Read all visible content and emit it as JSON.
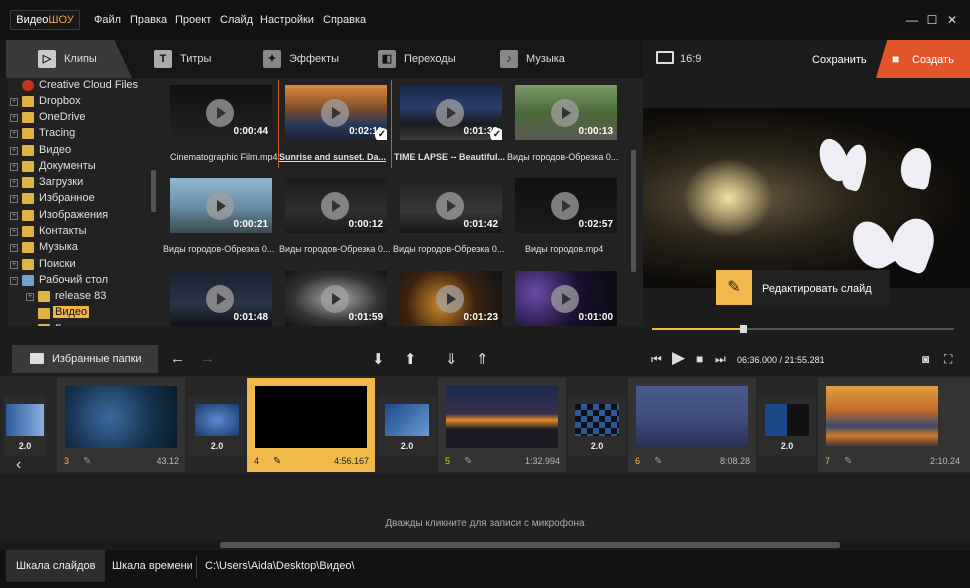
{
  "app": {
    "logo_a": "Видео",
    "logo_b": "ШОУ"
  },
  "menu": [
    "Файл",
    "Правка",
    "Проект",
    "Слайд",
    "Настройки",
    "Справка"
  ],
  "tabs": [
    {
      "label": "Клипы",
      "icon": "play-icon"
    },
    {
      "label": "Титры",
      "icon": "text-icon"
    },
    {
      "label": "Эффекты",
      "icon": "magic-wand-icon"
    },
    {
      "label": "Переходы",
      "icon": "transition-icon"
    },
    {
      "label": "Музыка",
      "icon": "music-icon"
    }
  ],
  "header": {
    "aspect": "16:9",
    "save": "Сохранить",
    "create": "Создать"
  },
  "tree": [
    {
      "label": "Creative Cloud Files",
      "type": "cloud"
    },
    {
      "label": "Dropbox",
      "type": "folder"
    },
    {
      "label": "OneDrive",
      "type": "folder"
    },
    {
      "label": "Tracing",
      "type": "folder"
    },
    {
      "label": "Видео",
      "type": "folder"
    },
    {
      "label": "Документы",
      "type": "folder"
    },
    {
      "label": "Загрузки",
      "type": "folder"
    },
    {
      "label": "Избранное",
      "type": "folder"
    },
    {
      "label": "Изображения",
      "type": "folder"
    },
    {
      "label": "Контакты",
      "type": "folder"
    },
    {
      "label": "Музыка",
      "type": "folder"
    },
    {
      "label": "Поиски",
      "type": "folder"
    },
    {
      "label": "Рабочий стол",
      "type": "folder"
    },
    {
      "label": "release 83",
      "type": "folder"
    },
    {
      "label": "Видео",
      "type": "folder-selected"
    },
    {
      "label": "Б",
      "type": "folder"
    }
  ],
  "clips": [
    {
      "name": "Cinematographic Film.mp4",
      "dur": "0:00:44",
      "checked": false
    },
    {
      "name": "Sunrise and sunset. Da...",
      "dur": "0:02:11",
      "checked": true
    },
    {
      "name": "TIME LAPSE -- Beautiful...",
      "dur": "0:01:33",
      "checked": true
    },
    {
      "name": "Виды городов-Обрезка 0...",
      "dur": "0:00:13",
      "checked": false
    },
    {
      "name": "Виды городов-Обрезка 0...",
      "dur": "0:00:21",
      "checked": false
    },
    {
      "name": "Виды городов-Обрезка 0...",
      "dur": "0:00:12",
      "checked": false
    },
    {
      "name": "Виды городов-Обрезка 0...",
      "dur": "0:01:42",
      "checked": false
    },
    {
      "name": "Виды городов.mp4",
      "dur": "0:02:57",
      "checked": false
    },
    {
      "name": "",
      "dur": "0:01:48",
      "checked": false
    },
    {
      "name": "",
      "dur": "0:01:59",
      "checked": false
    },
    {
      "name": "",
      "dur": "0:01:23",
      "checked": false
    },
    {
      "name": "",
      "dur": "0:01:00",
      "checked": false
    }
  ],
  "preview": {
    "edit_label": "Редактировать слайд",
    "time": "06:36.000 / 21:55.281",
    "progress": 0.3
  },
  "toolbar": {
    "fav_label": "Избранные папки"
  },
  "slides": [
    {
      "num": "3",
      "dur": "43.12"
    },
    {
      "num": "4",
      "dur": "4:56.167"
    },
    {
      "num": "5",
      "dur": "1:32.994"
    },
    {
      "num": "6",
      "dur": "8:08.28"
    },
    {
      "num": "7",
      "dur": "2:10.24"
    }
  ],
  "transitions": [
    "2.0",
    "2.0",
    "2.0",
    "2.0",
    "2.0"
  ],
  "mic_hint": "Дважды кликните для записи с микрофона",
  "bottom": {
    "tab1": "Шкала слайдов",
    "tab2": "Шкала времени",
    "path": "C:\\Users\\Aida\\Desktop\\Видео\\"
  }
}
